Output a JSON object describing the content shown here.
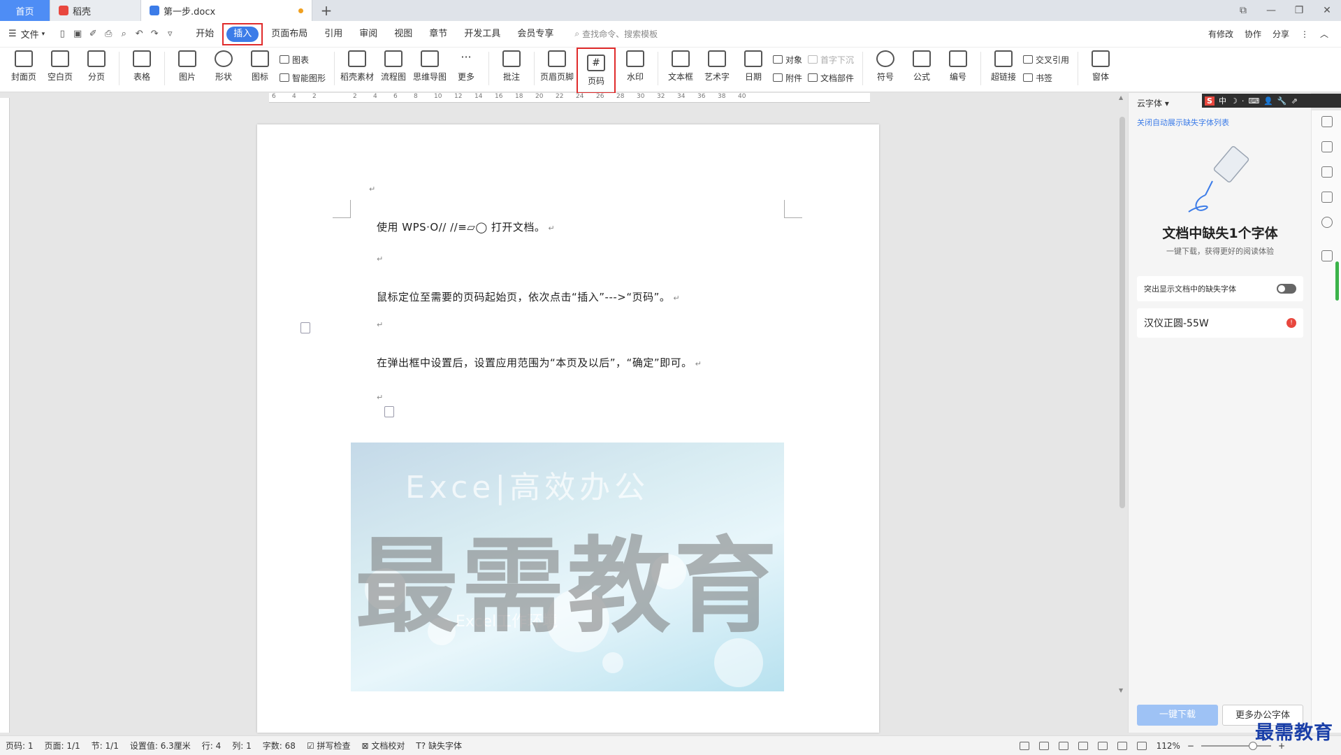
{
  "tabs": [
    {
      "label": "首页"
    },
    {
      "label": "稻壳"
    },
    {
      "label": "第一步.docx"
    }
  ],
  "new_tab": "+",
  "window_controls": [
    "⧉",
    "—",
    "❐",
    "✕"
  ],
  "menubar": {
    "file": "文件",
    "tabs": [
      "开始",
      "插入",
      "页面布局",
      "引用",
      "审阅",
      "视图",
      "章节",
      "开发工具",
      "会员专享"
    ],
    "active_tab": "插入",
    "search_placeholder": "查找命令、搜索模板",
    "right": [
      "有修改",
      "协作",
      "分享"
    ]
  },
  "ribbon": {
    "g1": [
      "封面页",
      "空白页",
      "分页"
    ],
    "table": "表格",
    "g2": [
      "图片",
      "形状",
      "图标"
    ],
    "chart_items": [
      "图表",
      "智能图形"
    ],
    "g3": [
      "稻壳素材",
      "流程图",
      "思维导图",
      "更多"
    ],
    "comment": "批注",
    "header_footer": "页眉页脚",
    "page_number": "页码",
    "watermark": "水印",
    "g4": [
      "文本框",
      "艺术字",
      "日期"
    ],
    "obj_items": [
      "对象",
      "附件"
    ],
    "dropcap_items": [
      "首字下沉",
      "文档部件"
    ],
    "g5": [
      "符号",
      "公式",
      "编号"
    ],
    "hyperlink": "超链接",
    "xref_items": [
      "交叉引用",
      "书签"
    ],
    "window": "窗体"
  },
  "ruler_ticks": [
    "6",
    "4",
    "2",
    "",
    "2",
    "4",
    "6",
    "8",
    "10",
    "12",
    "14",
    "16",
    "18",
    "20",
    "22",
    "24",
    "26",
    "28",
    "30",
    "32",
    "34",
    "36",
    "38",
    "40"
  ],
  "document": {
    "lines": [
      "使用 WPS·O// //≡▱◯ 打开文档。",
      "鼠标定位至需要的页码起始页，依次点击“插入”--->“页码”。",
      "在弹出框中设置后，设置应用范围为“本页及以后”，“确定”即可。"
    ],
    "return_mark": "↵",
    "hero_top": "Exce|高效办公",
    "hero_mid": "Excel工作环境",
    "watermark": "最需教育"
  },
  "right_panel": {
    "title": "云字体",
    "link": "关闭自动展示缺失字体列表",
    "heading": "文档中缺失1个字体",
    "sub": "一键下载，获得更好的阅读体验",
    "toggle_label": "突出显示文档中的缺失字体",
    "missing_font": "汉仪正圆-55W",
    "download_btn": "一键下载",
    "more_btn": "更多办公字体"
  },
  "ime": [
    "S",
    "中",
    "☽",
    "·",
    "⌨",
    "👤",
    "🔧",
    "⇗"
  ],
  "status": {
    "page_code": "页码: 1",
    "page": "页面: 1/1",
    "section": "节: 1/1",
    "setting": "设置值: 6.3厘米",
    "row": "行: 4",
    "col": "列: 1",
    "words": "字数: 68",
    "spell": "拼写检查",
    "proof": "文档校对",
    "missing_font": "缺失字体",
    "zoom": "112%"
  },
  "brand": "最需教育"
}
